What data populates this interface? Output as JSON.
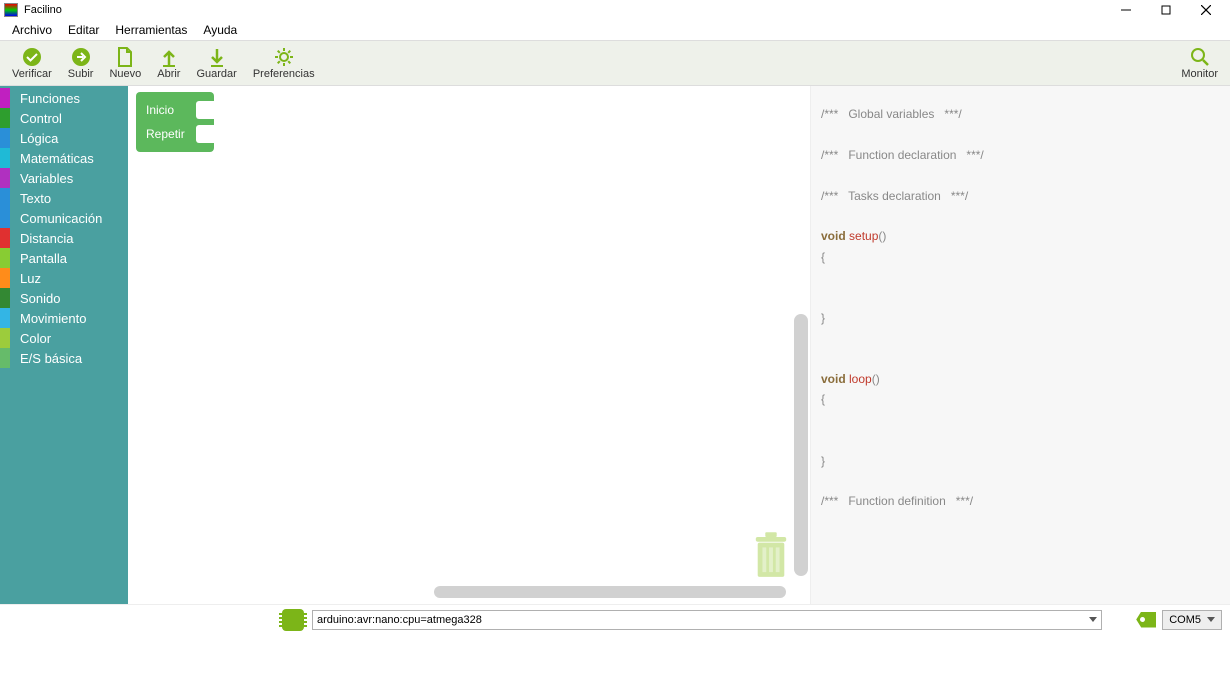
{
  "window": {
    "title": "Facilino"
  },
  "menu": {
    "archivo": "Archivo",
    "editar": "Editar",
    "herramientas": "Herramientas",
    "ayuda": "Ayuda"
  },
  "toolbar": {
    "verificar": "Verificar",
    "subir": "Subir",
    "nuevo": "Nuevo",
    "abrir": "Abrir",
    "guardar": "Guardar",
    "preferencias": "Preferencias",
    "monitor": "Monitor"
  },
  "categories": [
    {
      "label": "Funciones",
      "color": "#c020c0"
    },
    {
      "label": "Control",
      "color": "#2e9e2e"
    },
    {
      "label": "Lógica",
      "color": "#2a8fd8"
    },
    {
      "label": "Matemáticas",
      "color": "#1fbad6"
    },
    {
      "label": "Variables",
      "color": "#b030c0"
    },
    {
      "label": "Texto",
      "color": "#2a8fd8"
    },
    {
      "label": "Comunicación",
      "color": "#2a8fd8"
    },
    {
      "label": "Distancia",
      "color": "#e03030"
    },
    {
      "label": "Pantalla",
      "color": "#88cc33"
    },
    {
      "label": "Luz",
      "color": "#ff8c1a"
    },
    {
      "label": "Sonido",
      "color": "#338833"
    },
    {
      "label": "Movimiento",
      "color": "#33b5e5"
    },
    {
      "label": "Color",
      "color": "#9ccc3c"
    },
    {
      "label": "E/S básica",
      "color": "#66bb6a"
    }
  ],
  "block": {
    "inicio": "Inicio",
    "repetir": "Repetir"
  },
  "code": {
    "c1": "/***   Global variables   ***/",
    "c2": "/***   Function declaration   ***/",
    "c3": "/***   Tasks declaration   ***/",
    "kw_void1": "void ",
    "fn_setup": "setup",
    "paren1": "()",
    "ob1": "{",
    "cb1": "}",
    "kw_void2": "void ",
    "fn_loop": "loop",
    "paren2": "()",
    "ob2": "{",
    "cb2": "}",
    "c4": "/***   Function definition   ***/"
  },
  "status": {
    "board": "arduino:avr:nano:cpu=atmega328",
    "port": "COM5"
  }
}
